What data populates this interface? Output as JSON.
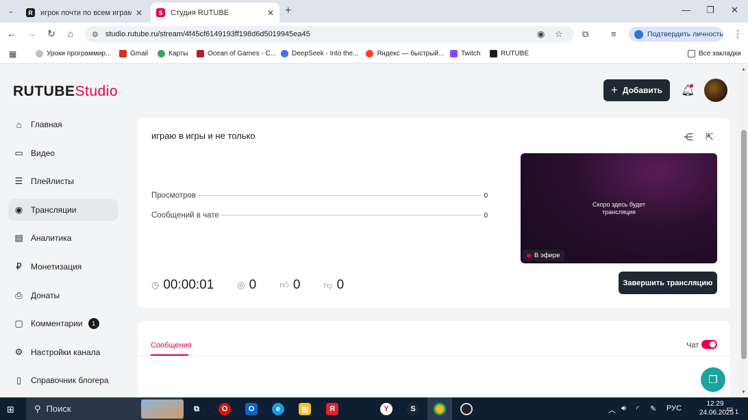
{
  "browser": {
    "tabs": [
      {
        "title": "игрок почти по всем играм. С",
        "active": false
      },
      {
        "title": "Студия RUTUBE",
        "active": true
      }
    ],
    "url": "studio.rutube.ru/stream/4f45cf6149193ff198d6d5019945ea45",
    "verify_label": "Подтвердить личность",
    "bookmarks": [
      "Уроки программир...",
      "Gmail",
      "Карты",
      "Ocean of Games - C...",
      "DeepSeek - Into the...",
      "Яндекс — быстрый...",
      "Twitch",
      "RUTUBE"
    ],
    "all_bookmarks": "Все закладки",
    "colors": {
      "tabbar": "#dfe3eb",
      "omnibox": "#eef1f6"
    }
  },
  "header": {
    "logo_main": "RUTUBE",
    "logo_sub": "Studio",
    "add_button": "Добавить"
  },
  "sidebar": {
    "items": [
      {
        "label": "Главная",
        "icon": "home-icon"
      },
      {
        "label": "Видео",
        "icon": "video-icon"
      },
      {
        "label": "Плейлисты",
        "icon": "playlist-icon"
      },
      {
        "label": "Трансляции",
        "icon": "broadcast-icon",
        "active": true
      },
      {
        "label": "Аналитика",
        "icon": "analytics-icon"
      },
      {
        "label": "Монетизация",
        "icon": "ruble-icon"
      },
      {
        "label": "Донаты",
        "icon": "donate-icon"
      },
      {
        "label": "Комментарии",
        "icon": "comments-icon",
        "badge": "1"
      },
      {
        "label": "Настройки канала",
        "icon": "settings-icon"
      },
      {
        "label": "Справочник блогера",
        "icon": "book-icon"
      }
    ]
  },
  "stream": {
    "title": "играю в игры и не только",
    "stats": [
      {
        "label": "Просмотров",
        "value": "0"
      },
      {
        "label": "Сообщений в чате",
        "value": "0"
      }
    ],
    "preview_text_1": "Скоро здесь будет",
    "preview_text_2": "трансляция",
    "live_label": "В эфире",
    "duration": "00:00:01",
    "viewers": "0",
    "likes": "0",
    "dislikes": "0",
    "end_button": "Завершить трансляцию",
    "accent": "#e3004f"
  },
  "chat": {
    "tab_label": "Сообщения",
    "chat_label": "Чат",
    "chat_enabled": true
  },
  "taskbar": {
    "search_label": "Поиск",
    "lang": "РУС",
    "time": "12:29",
    "date": "24.06.2025",
    "notifications": "1"
  }
}
